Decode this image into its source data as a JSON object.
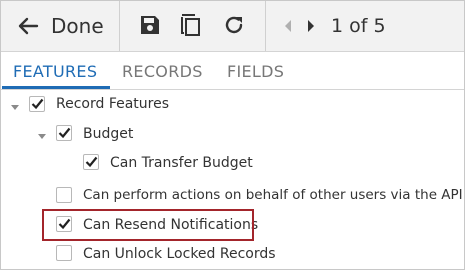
{
  "toolbar": {
    "done_label": "Done",
    "pager_label": "1 of 5",
    "icons": [
      "back-arrow-icon",
      "save-icon",
      "copy-icon",
      "refresh-icon",
      "previous-icon",
      "next-icon"
    ]
  },
  "tabs": [
    {
      "label": "FEATURES",
      "active": true
    },
    {
      "label": "RECORDS",
      "active": false
    },
    {
      "label": "FIELDS",
      "active": false
    }
  ],
  "tree": {
    "record_features": {
      "label": "Record Features",
      "checked": true,
      "expanded": true
    },
    "budget": {
      "label": "Budget",
      "checked": true,
      "expanded": true
    },
    "can_transfer_budget": {
      "label": "Can Transfer Budget",
      "checked": true
    },
    "can_act_on_behalf": {
      "label": "Can perform actions on behalf of other users via the API",
      "checked": false
    },
    "can_resend_notifications": {
      "label": "Can Resend Notifications",
      "checked": true
    },
    "can_unlock_records": {
      "label": "Can Unlock Locked Records",
      "checked": false
    }
  },
  "colors": {
    "accent": "#1f6cb5",
    "highlight": "#a3252b",
    "toolbar_bg": "#f2f2f2"
  }
}
